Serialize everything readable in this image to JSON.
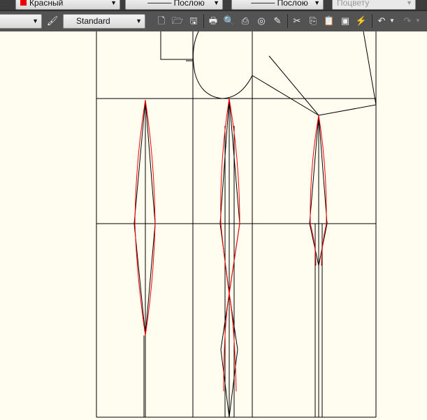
{
  "toolbar_top": {
    "color": "Красный",
    "linetype": "Послою",
    "lineweight": "Послою",
    "plotstyle": "Поцвету"
  },
  "toolbar_main": {
    "style": "Standard"
  },
  "colors": {
    "canvas": "#fffcf0",
    "red": "#ff0000"
  }
}
